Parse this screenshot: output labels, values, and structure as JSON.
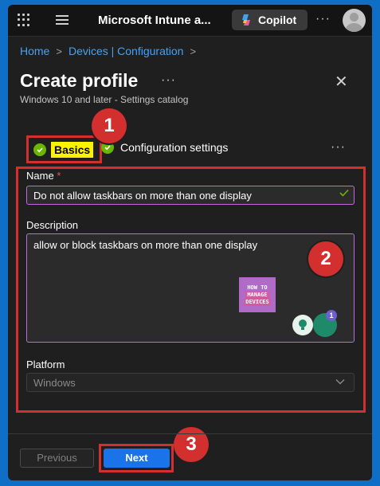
{
  "topbar": {
    "app_title": "Microsoft Intune a...",
    "copilot_label": "Copilot",
    "more": "···"
  },
  "breadcrumb": {
    "items": [
      "Home",
      "Devices | Configuration"
    ],
    "separator": ">"
  },
  "header": {
    "title": "Create profile",
    "more": "···",
    "close": "✕",
    "subtitle": "Windows 10 and later - Settings catalog"
  },
  "tabs": {
    "basics": "Basics",
    "config": "Configuration settings",
    "more": "···"
  },
  "form": {
    "name_label": "Name",
    "required_mark": "*",
    "name_value": "Do not allow taskbars on more than one display",
    "description_label": "Description",
    "description_value": "allow  or block taskbars on more than one display",
    "platform_label": "Platform",
    "platform_value": "Windows"
  },
  "watermark": {
    "line1": "HOW TO",
    "line2": "MANAGE",
    "line3": "DEVICES"
  },
  "fab": {
    "badge": "1"
  },
  "callouts": {
    "one": "1",
    "two": "2",
    "three": "3"
  },
  "footer": {
    "previous": "Previous",
    "next": "Next"
  },
  "colors": {
    "accent": "#1a73e8",
    "highlight_red": "#d32f2f",
    "success": "#6bb700",
    "link": "#4aa0f0"
  }
}
